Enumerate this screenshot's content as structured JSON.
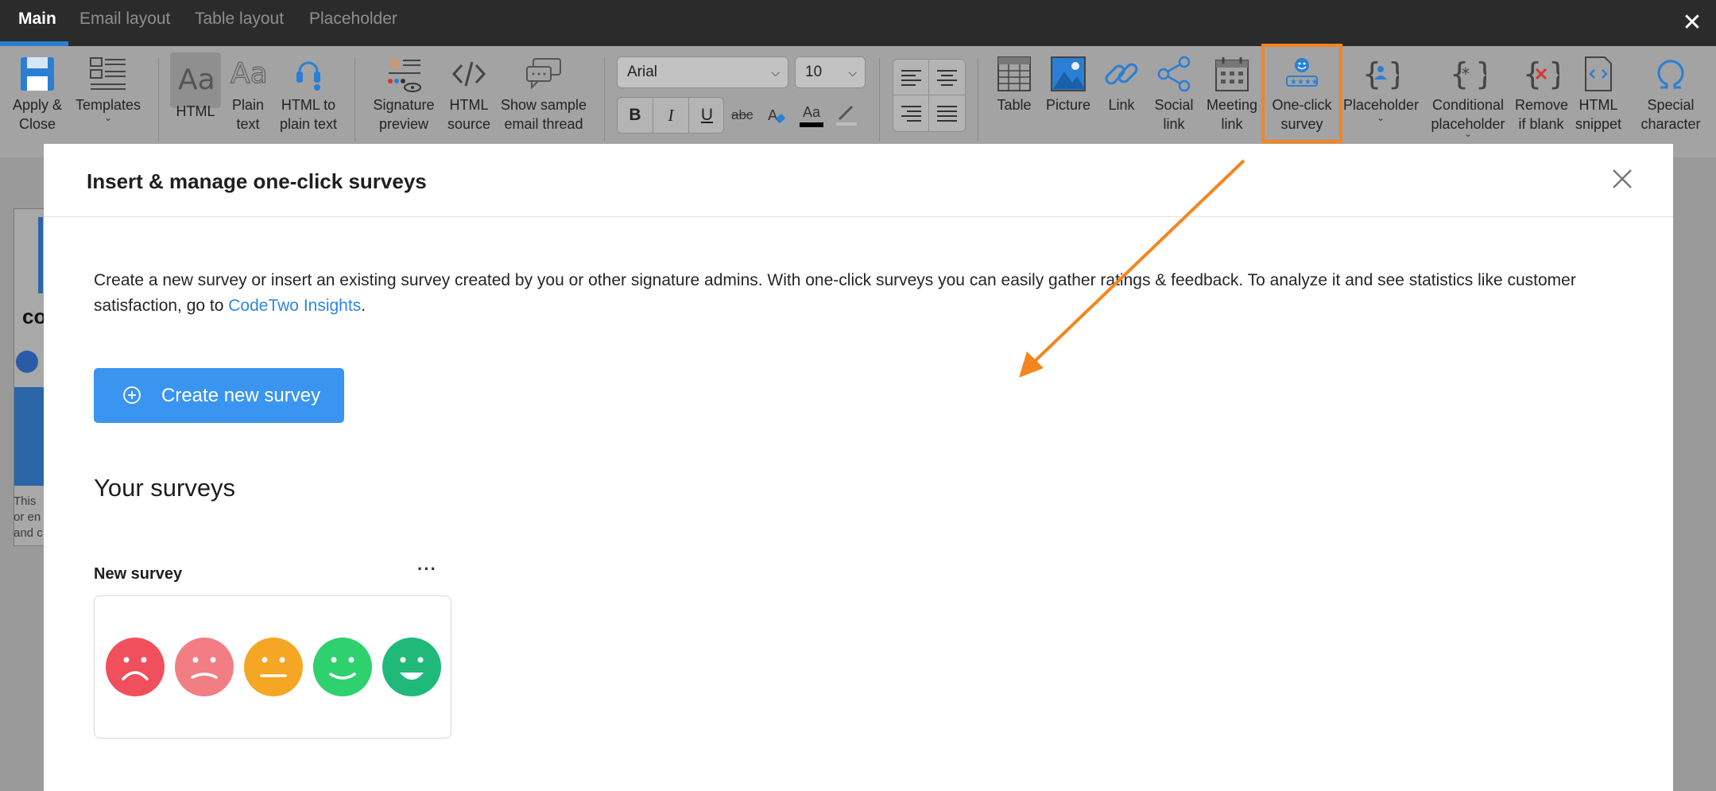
{
  "tabs": [
    {
      "label": "Main",
      "active": true
    },
    {
      "label": "Email layout",
      "active": false
    },
    {
      "label": "Table layout",
      "active": false
    },
    {
      "label": "Placeholder",
      "active": false
    }
  ],
  "window_close_label": "✕",
  "ribbon": {
    "apply_close": "Apply & Close",
    "templates": "Templates",
    "html": "HTML",
    "plain_text": "Plain text",
    "html_to_plain": "HTML to plain text",
    "signature_preview": "Signature preview",
    "html_source": "HTML source",
    "show_sample": "Show sample email thread",
    "font": "Arial",
    "font_size": "10",
    "bold": "B",
    "italic": "I",
    "underline": "U",
    "strikethrough": "abc",
    "font_color_label": "Aa",
    "table": "Table",
    "picture": "Picture",
    "link": "Link",
    "social_link": "Social link",
    "meeting_link": "Meeting link",
    "one_click_survey": "One-click survey",
    "placeholder": "Placeholder",
    "conditional_placeholder": "Conditional placeholder",
    "remove_if_blank": "Remove if blank",
    "html_snippet": "HTML snippet",
    "special_character": "Special character"
  },
  "background_doc": {
    "logo_fragment": "co",
    "line1": "This",
    "line2": "or en",
    "line3": "and c"
  },
  "modal": {
    "title": "Insert & manage one-click surveys",
    "description": "Create a new survey or insert an existing survey created by you or other signature admins. With one-click surveys you can easily gather ratings & feedback. To analyze it and see statistics like customer satisfaction, go to ",
    "link_text": "CodeTwo Insights",
    "description_end": ".",
    "create_button": "Create new survey",
    "your_surveys_heading": "Your surveys",
    "survey": {
      "name": "New survey",
      "menu": "···",
      "faces": [
        {
          "mood": "very-unhappy",
          "color": "#f0505c"
        },
        {
          "mood": "unhappy",
          "color": "#f27e84"
        },
        {
          "mood": "neutral",
          "color": "#f5a623"
        },
        {
          "mood": "happy",
          "color": "#2ed16d"
        },
        {
          "mood": "very-happy",
          "color": "#20b97a"
        }
      ]
    }
  },
  "colors": {
    "accent": "#3a95f0",
    "highlight": "#f5851f",
    "link": "#2f86e0"
  }
}
